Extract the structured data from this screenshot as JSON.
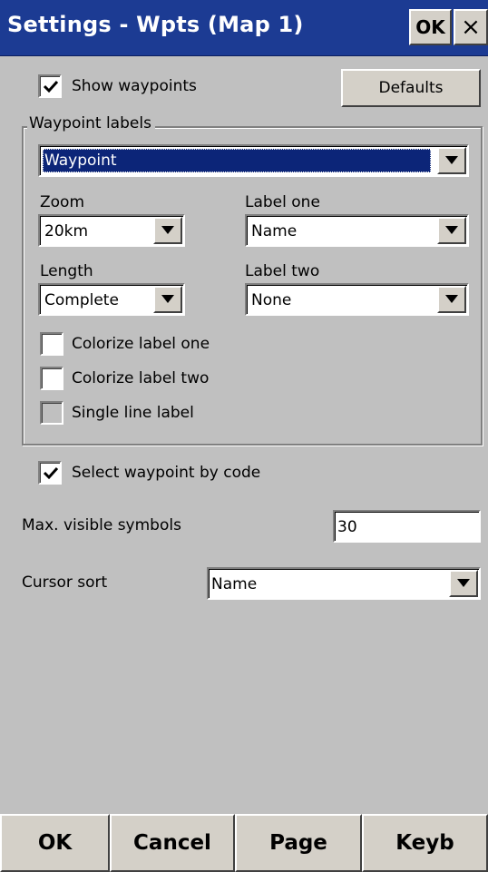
{
  "window": {
    "title": "Settings - Wpts (Map 1)",
    "ok_label": "OK",
    "close_label": "×"
  },
  "show_waypoints": {
    "label": "Show waypoints",
    "checked": true
  },
  "defaults_button": "Defaults",
  "waypoint_labels": {
    "legend": "Waypoint labels",
    "type_value": "Waypoint",
    "zoom_label": "Zoom",
    "zoom_value": "20km",
    "label_one_label": "Label one",
    "label_one_value": "Name",
    "length_label": "Length",
    "length_value": "Complete",
    "label_two_label": "Label two",
    "label_two_value": "None",
    "colorize_one": {
      "label": "Colorize label one",
      "checked": false
    },
    "colorize_two": {
      "label": "Colorize label two",
      "checked": false
    },
    "single_line": {
      "label": "Single line label",
      "checked": false,
      "enabled": false
    }
  },
  "select_by_code": {
    "label": "Select waypoint by code",
    "checked": true
  },
  "max_symbols": {
    "label": "Max. visible symbols",
    "value": "30"
  },
  "cursor_sort": {
    "label": "Cursor sort",
    "value": "Name"
  },
  "bottom_bar": {
    "ok": "OK",
    "cancel": "Cancel",
    "page": "Page",
    "keyb": "Keyb"
  },
  "colors": {
    "title_bar": "#1c3b93",
    "background": "#c0c0c0",
    "selection": "#0c2578"
  }
}
